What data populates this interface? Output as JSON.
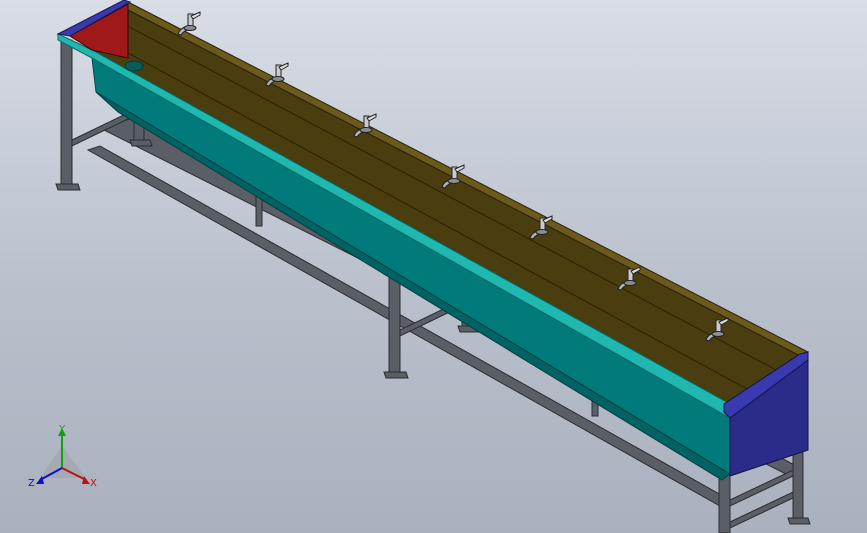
{
  "viewport": {
    "background_top": "#d8dde6",
    "background_bottom": "#aab1be"
  },
  "model": {
    "basin_inner_color": "#4a3d10",
    "basin_rim_color": "#5e4e15",
    "trough_front_color": "#007a7a",
    "trough_edge_color": "#1fb8b0",
    "left_end_cap_color": "#a01818",
    "right_end_cap_color": "#2b2b8a",
    "frame_color": "#5a5e66",
    "faucet_count": 7
  },
  "triad": {
    "x_label": "X",
    "y_label": "Y",
    "z_label": "Z",
    "x_color": "#c01010",
    "y_color": "#10a010",
    "z_color": "#1010c0"
  }
}
